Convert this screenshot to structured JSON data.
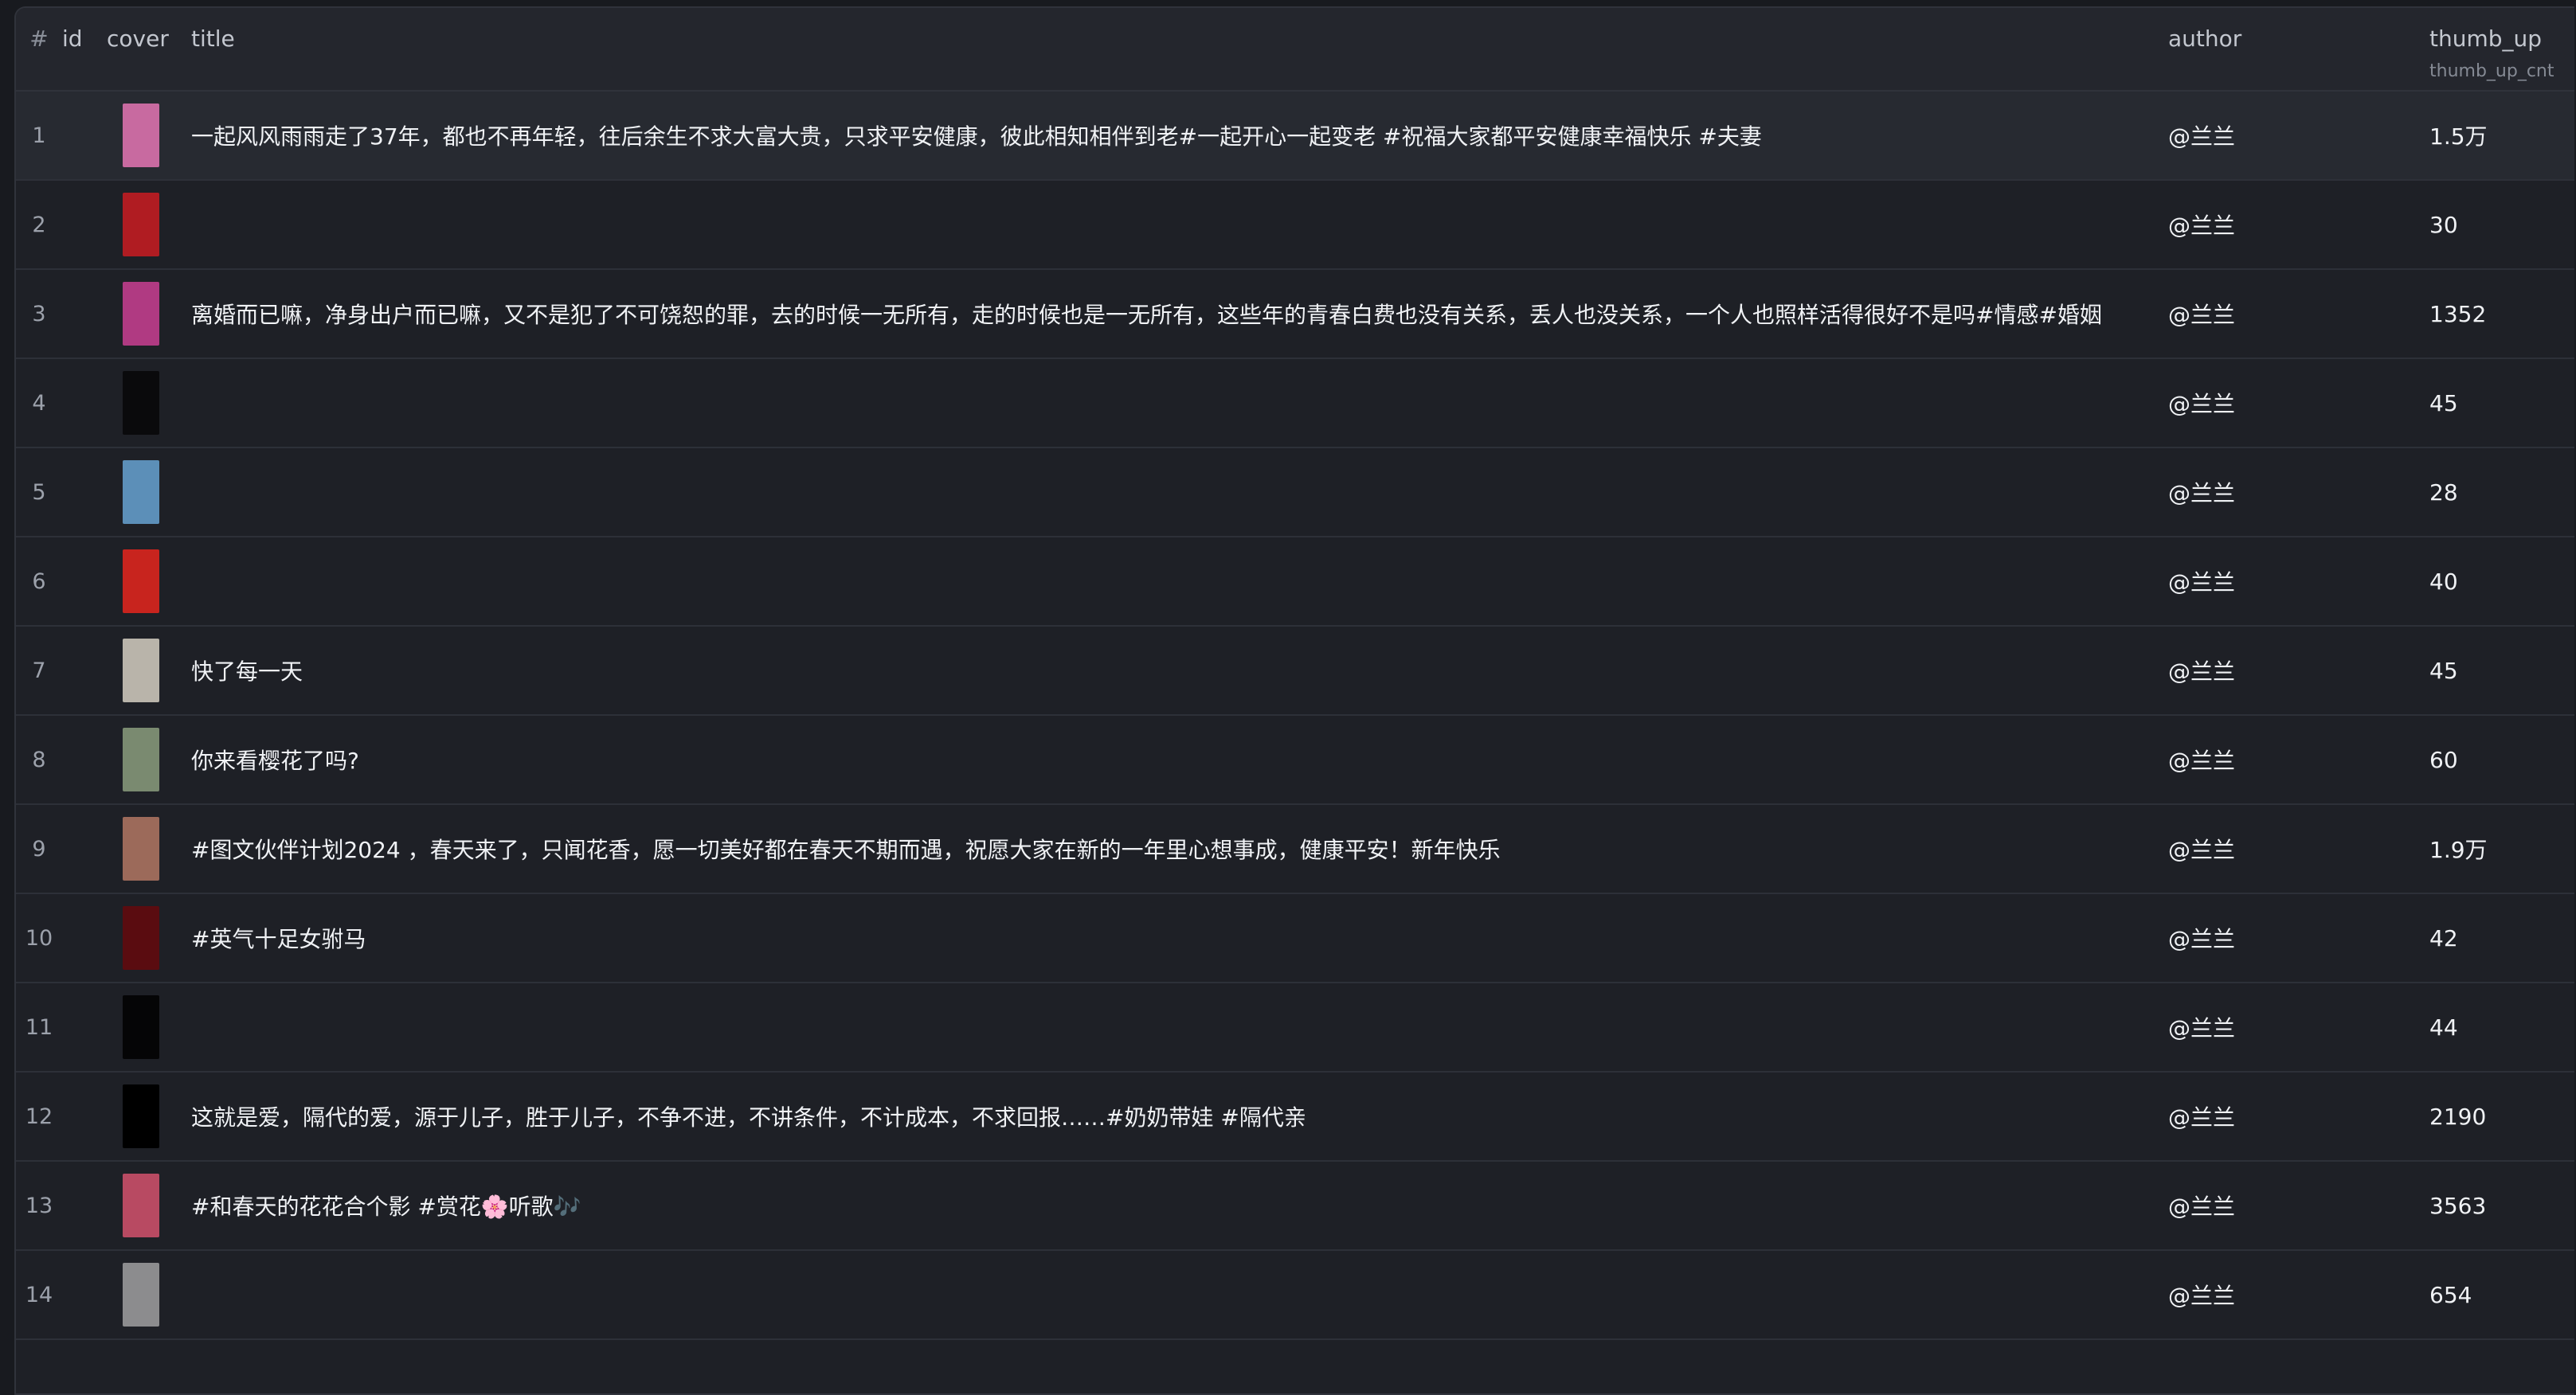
{
  "headers": {
    "num": "#",
    "id": "id",
    "cover": "cover",
    "title": "title",
    "author": "author",
    "thumb_up": "thumb_up",
    "thumb_up_sub": "thumb_up_cnt"
  },
  "rows": [
    {
      "num": "1",
      "title": "一起风风雨雨走了37年，都也不再年轻，往后余生不求大富大贵，只求平安健康，彼此相知相伴到老#一起开心一起变老 #祝福大家都平安健康幸福快乐 #夫妻",
      "author": "@兰兰",
      "thumb_up": "1.5万",
      "cover_color": "#c86aa0"
    },
    {
      "num": "2",
      "title": "",
      "author": "@兰兰",
      "thumb_up": "30",
      "cover_color": "#b01c22"
    },
    {
      "num": "3",
      "title": "离婚而已嘛，净身出户而已嘛，又不是犯了不可饶恕的罪，去的时候一无所有，走的时候也是一无所有，这些年的青春白费也没有关系，丢人也没关系，一个人也照样活得很好不是吗#情感#婚姻",
      "author": "@兰兰",
      "thumb_up": "1352",
      "cover_color": "#b03a82"
    },
    {
      "num": "4",
      "title": "",
      "author": "@兰兰",
      "thumb_up": "45",
      "cover_color": "#0a0a0c"
    },
    {
      "num": "5",
      "title": "",
      "author": "@兰兰",
      "thumb_up": "28",
      "cover_color": "#5c8fb8"
    },
    {
      "num": "6",
      "title": "",
      "author": "@兰兰",
      "thumb_up": "40",
      "cover_color": "#c8241e"
    },
    {
      "num": "7",
      "title": "快了每一天",
      "author": "@兰兰",
      "thumb_up": "45",
      "cover_color": "#b9b4aa"
    },
    {
      "num": "8",
      "title": "你来看樱花了吗?",
      "author": "@兰兰",
      "thumb_up": "60",
      "cover_color": "#7a8a70"
    },
    {
      "num": "9",
      "title": "#图文伙伴计划2024 ，春天来了，只闻花香，愿一切美好都在春天不期而遇，祝愿大家在新的一年里心想事成，健康平安！新年快乐",
      "author": "@兰兰",
      "thumb_up": "1.9万",
      "cover_color": "#9c6a5a"
    },
    {
      "num": "10",
      "title": "#英气十足女驸马",
      "author": "@兰兰",
      "thumb_up": "42",
      "cover_color": "#5a0c10"
    },
    {
      "num": "11",
      "title": "",
      "author": "@兰兰",
      "thumb_up": "44",
      "cover_color": "#050506"
    },
    {
      "num": "12",
      "title": "这就是爱，隔代的爱，源于儿子，胜于儿子，不争不进，不讲条件，不计成本，不求回报……#奶奶带娃 #隔代亲",
      "author": "@兰兰",
      "thumb_up": "2190",
      "cover_color": "#000000"
    },
    {
      "num": "13",
      "title": "#和春天的花花合个影 #赏花🌸听歌🎶",
      "author": "@兰兰",
      "thumb_up": "3563",
      "cover_color": "#b84a62"
    },
    {
      "num": "14",
      "title": "",
      "author": "@兰兰",
      "thumb_up": "654",
      "cover_color": "#8c8c8e"
    }
  ]
}
